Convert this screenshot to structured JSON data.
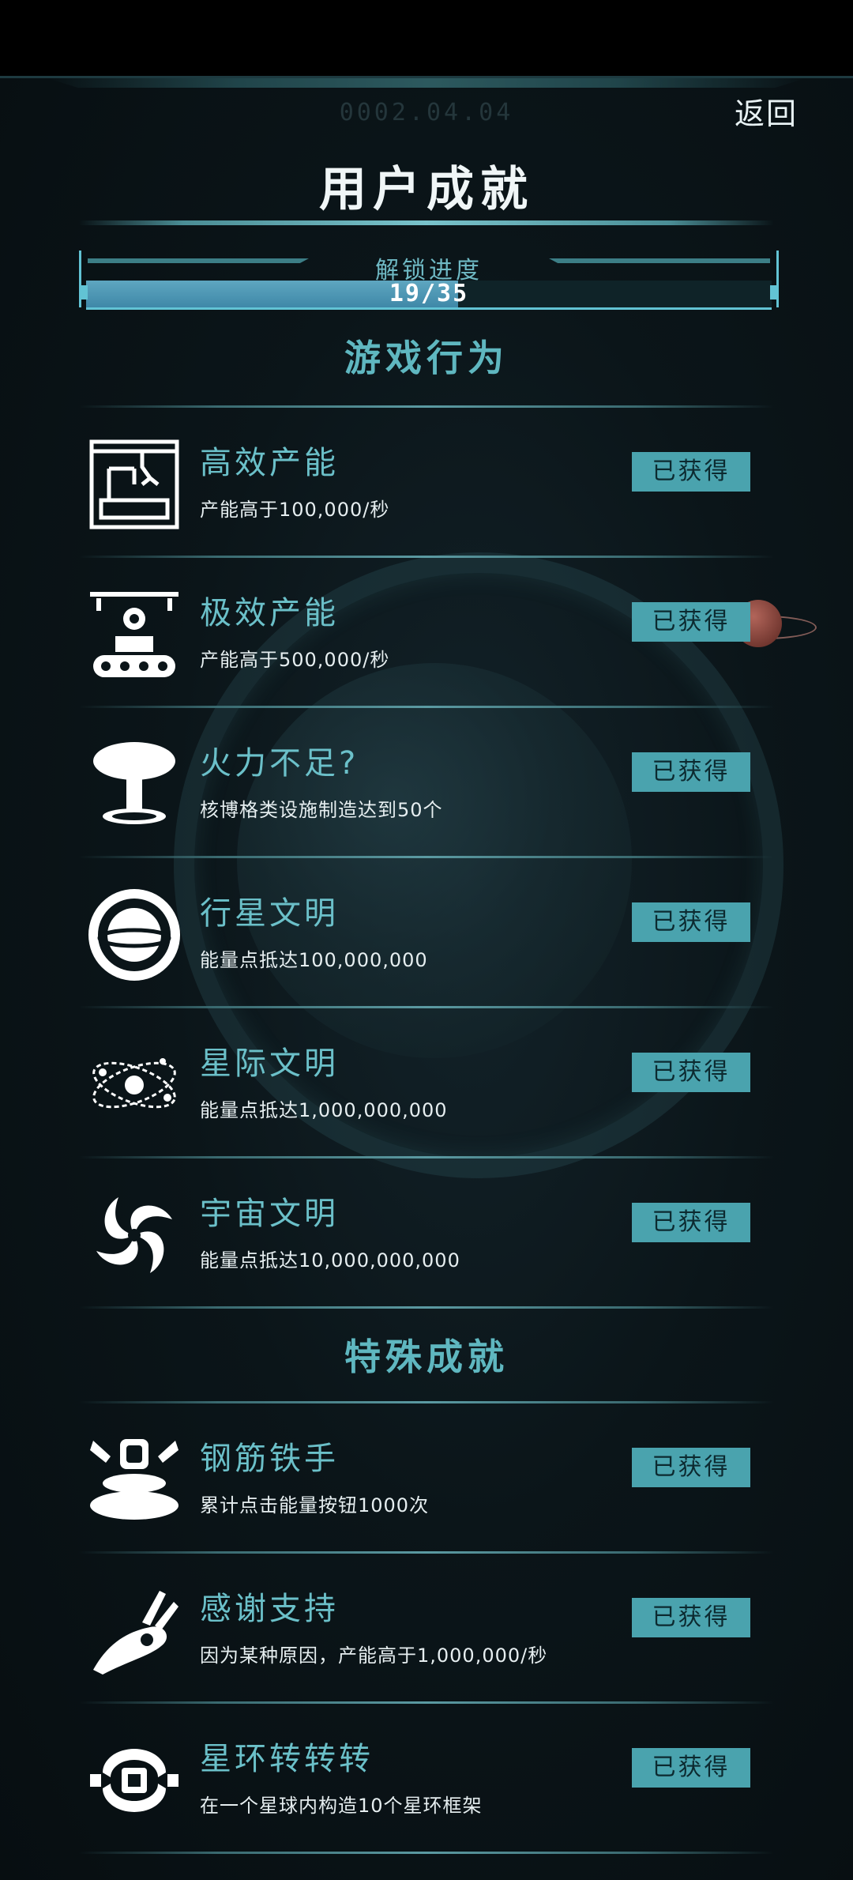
{
  "header": {
    "date": "0002.04.04",
    "back_label": "返回",
    "title": "用户成就"
  },
  "progress": {
    "label": "解锁进度",
    "text": "19/35",
    "unlocked": 19,
    "total": 35
  },
  "sections": [
    {
      "title": "游戏行为"
    },
    {
      "title": "特殊成就"
    }
  ],
  "items": [
    {
      "name": "高效产能",
      "desc": "产能高于100,000/秒",
      "badge": "已获得",
      "icon": "factory-robot-arm-icon"
    },
    {
      "name": "极效产能",
      "desc": "产能高于500,000/秒",
      "badge": "已获得",
      "icon": "gear-conveyor-icon"
    },
    {
      "name": "火力不足?",
      "desc": "核博格类设施制造达到50个",
      "badge": "已获得",
      "icon": "mushroom-cloud-icon"
    },
    {
      "name": "行星文明",
      "desc": "能量点抵达100,000,000",
      "badge": "已获得",
      "icon": "ringed-planet-icon"
    },
    {
      "name": "星际文明",
      "desc": "能量点抵达1,000,000,000",
      "badge": "已获得",
      "icon": "orbit-system-icon"
    },
    {
      "name": "宇宙文明",
      "desc": "能量点抵达10,000,000,000",
      "badge": "已获得",
      "icon": "spiral-galaxy-icon"
    },
    {
      "name": "钢筋铁手",
      "desc": "累计点击能量按钮1000次",
      "badge": "已获得",
      "icon": "press-button-icon"
    },
    {
      "name": "感谢支持",
      "desc": "因为某种原因，产能高于1,000,000/秒",
      "badge": "已获得",
      "icon": "ok-hand-icon"
    },
    {
      "name": "星环转转转",
      "desc": "在一个星球内构造10个星环框架",
      "badge": "已获得",
      "icon": "ring-frame-icon"
    }
  ],
  "colors": {
    "accent": "#5fb7c0",
    "badge_bg": "#4aa3ae",
    "panel_bg": "#0b1519"
  }
}
